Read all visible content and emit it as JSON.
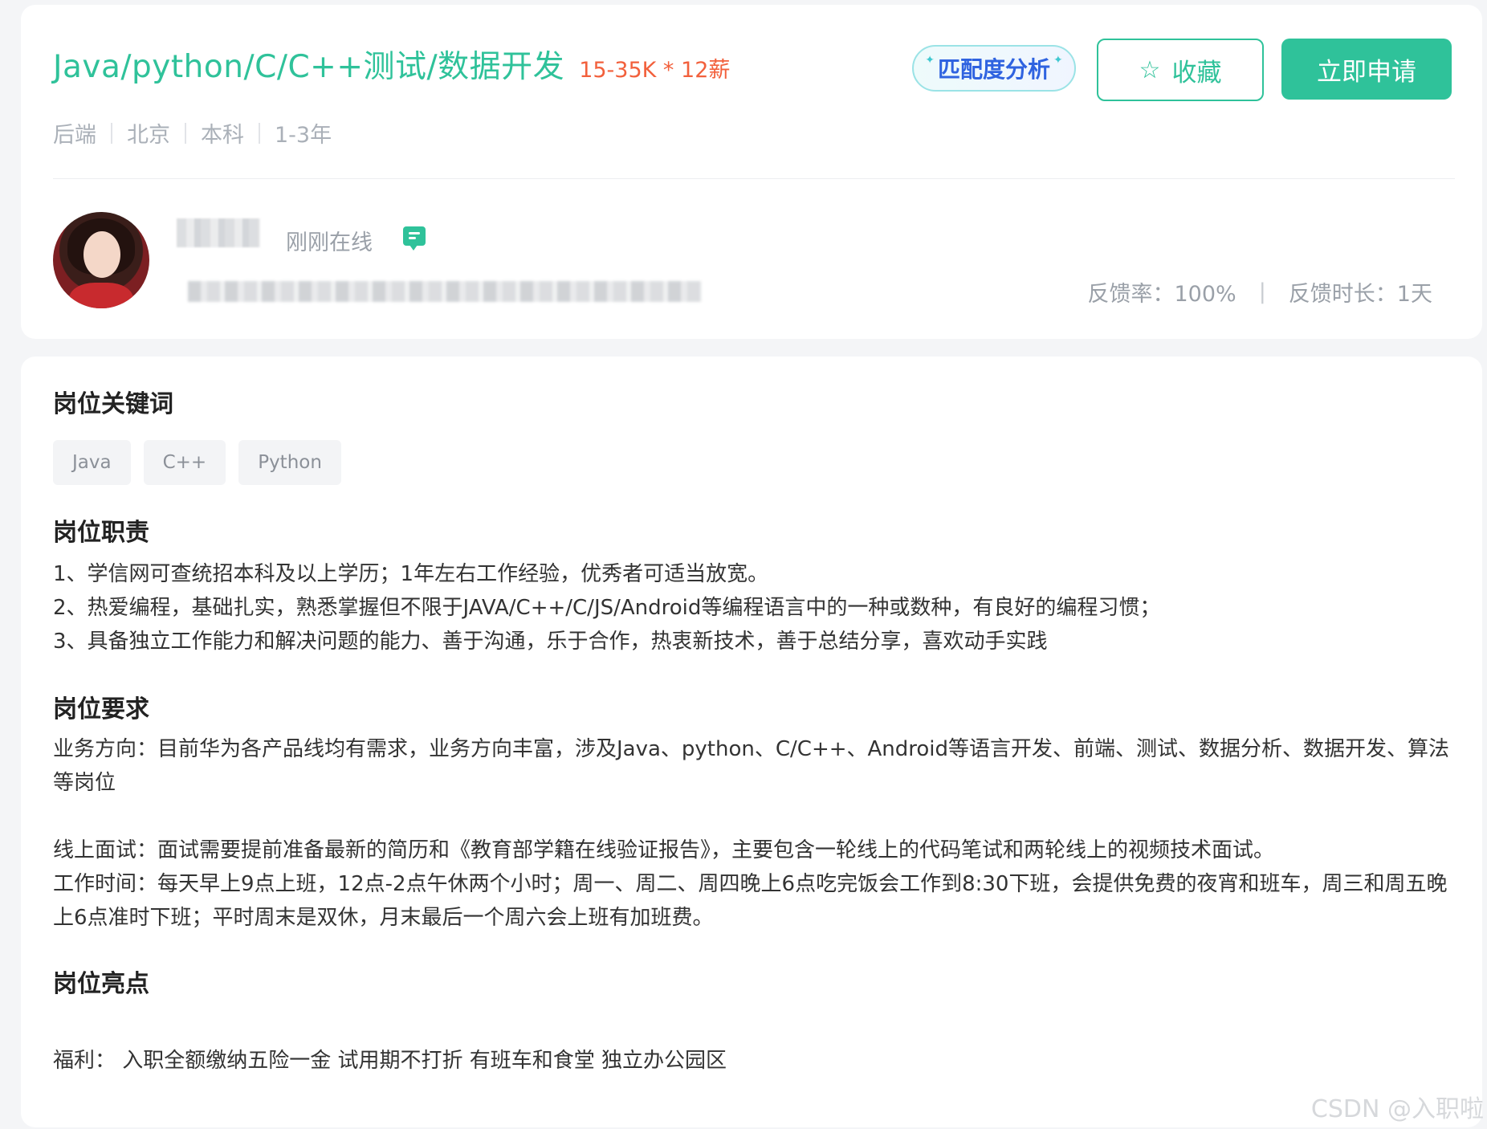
{
  "job": {
    "title": "Java/python/C/C++测试/数据开发",
    "salary": "15-35K * 12薪",
    "meta": [
      "后端",
      "北京",
      "本科",
      "1-3年"
    ]
  },
  "actions": {
    "match_label": "匹配度分析",
    "favorite_label": "收藏",
    "apply_label": "立即申请"
  },
  "recruiter": {
    "status": "刚刚在线",
    "feedback_rate": "反馈率：100%",
    "feedback_time": "反馈时长：1天"
  },
  "keywords": {
    "title": "岗位关键词",
    "items": [
      "Java",
      "C++",
      "Python"
    ]
  },
  "duties": {
    "title": "岗位职责",
    "lines": [
      "1、学信网可查统招本科及以上学历；1年左右工作经验，优秀者可适当放宽。",
      "2、热爱编程，基础扎实，熟悉掌握但不限于JAVA/C++/C/JS/Android等编程语言中的一种或数种，有良好的编程习惯；",
      "3、具备独立工作能力和解决问题的能力、善于沟通，乐于合作，热衷新技术，善于总结分享，喜欢动手实践"
    ]
  },
  "requirements": {
    "title": "岗位要求",
    "business": "业务方向：目前华为各产品线均有需求，业务方向丰富，涉及Java、python、C/C++、Android等语言开发、前端、测试、数据分析、数据开发、算法等岗位",
    "interview": "线上面试：面试需要提前准备最新的简历和《教育部学籍在线验证报告》，主要包含一轮线上的代码笔试和两轮线上的视频技术面试。",
    "worktime": "工作时间：每天早上9点上班，12点-2点午休两个小时；周一、周二、周四晚上6点吃完饭会工作到8:30下班，会提供免费的夜宵和班车，周三和周五晚上6点准时下班；平时周末是双休，月末最后一个周六会上班有加班费。"
  },
  "highlights": {
    "title": "岗位亮点",
    "benefits": "福利：  入职全额缴纳五险一金 试用期不打折 有班车和食堂 独立办公园区"
  },
  "watermark": "CSDN @入职啦",
  "colors": {
    "brand": "#2fc29a",
    "salary": "#f2603c",
    "match": "#2f63e0"
  }
}
